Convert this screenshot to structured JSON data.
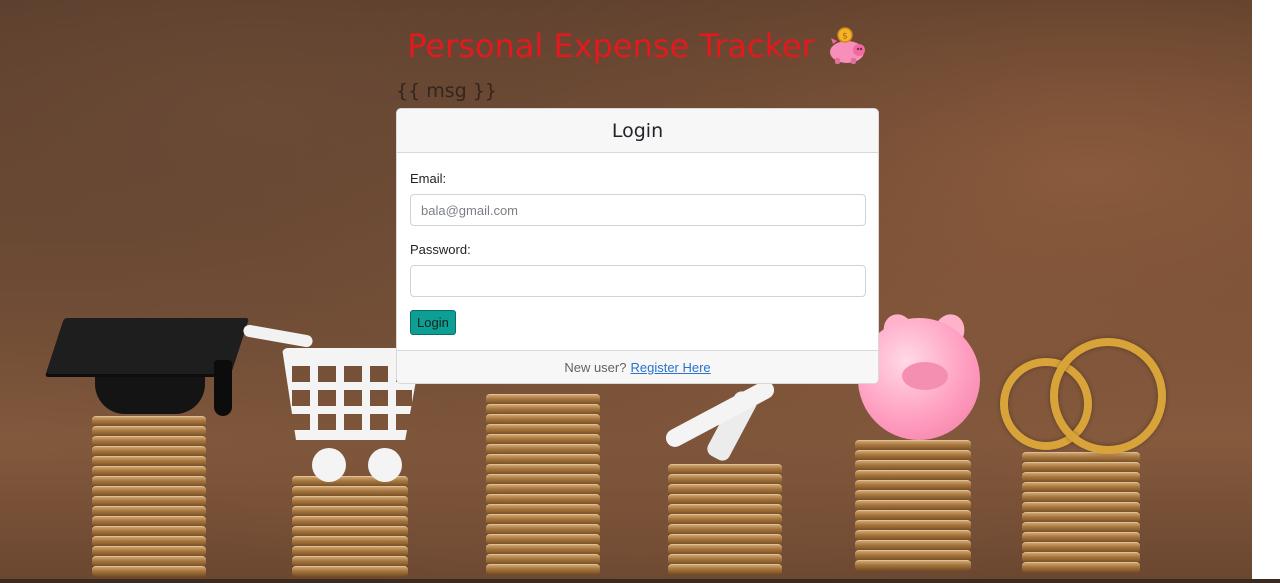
{
  "page": {
    "title": "Personal Expense Tracker",
    "title_icon": "piggy-bank-icon",
    "msg": "{{ msg }}"
  },
  "colors": {
    "title": "#e3191e",
    "button_bg": "#0d9f94",
    "link": "#2a73cf"
  },
  "login_card": {
    "header": "Login",
    "email": {
      "label": "Email:",
      "placeholder": "bala@gmail.com",
      "value": ""
    },
    "password": {
      "label": "Password:",
      "placeholder": "",
      "value": ""
    },
    "submit_label": "Login",
    "footer": {
      "prompt": "New user?",
      "link_text": "Register Here"
    }
  }
}
